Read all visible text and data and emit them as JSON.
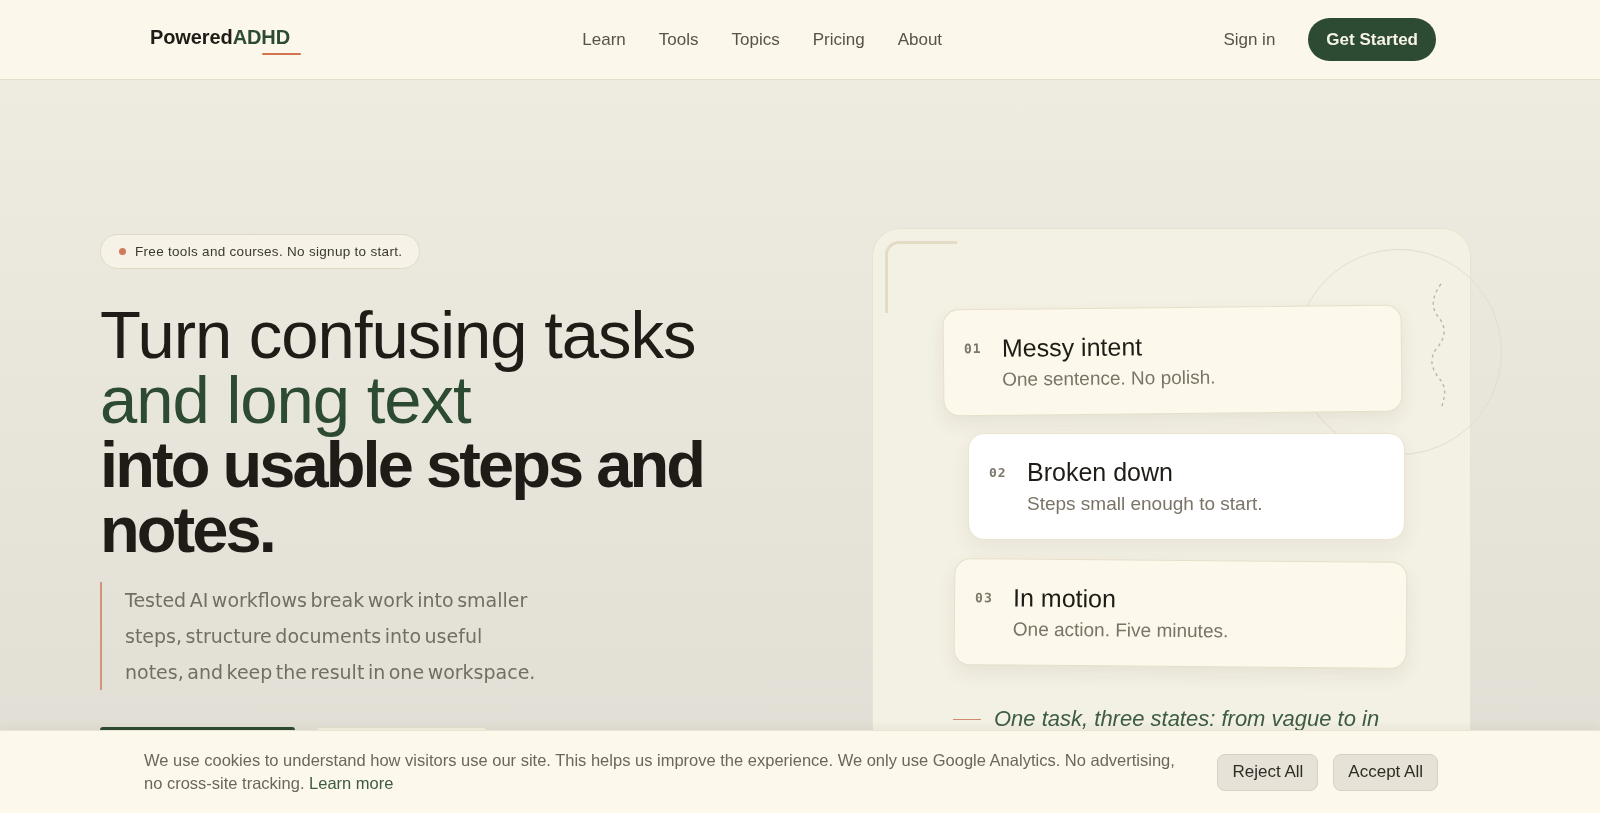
{
  "header": {
    "logo": {
      "text": "Powered",
      "accent": "ADHD"
    },
    "nav": [
      "Learn",
      "Tools",
      "Topics",
      "Pricing",
      "About"
    ],
    "sign_in": "Sign in",
    "cta": "Get Started"
  },
  "hero": {
    "badge": "Free tools and courses. No signup to start.",
    "headline": [
      {
        "text": "Turn confusing tasks",
        "kind": "regular"
      },
      {
        "text": "and long text",
        "kind": "accent"
      },
      {
        "text": "into usable steps and notes.",
        "kind": "strong"
      }
    ],
    "lead": "Tested AI workflows break work into smaller steps, structure documents into useful notes, and keep the result in one workspace.",
    "buttons": [
      {
        "kind": "primary"
      },
      {
        "kind": "secondary"
      }
    ]
  },
  "steps_panel": {
    "steps": [
      {
        "number": "01",
        "title": "Messy intent",
        "description": "One sentence. No polish.",
        "highlighted": false
      },
      {
        "number": "02",
        "title": "Broken down",
        "description": "Steps small enough to start.",
        "highlighted": true
      },
      {
        "number": "03",
        "title": "In motion",
        "description": "One action. Five minutes.",
        "highlighted": false
      }
    ],
    "caption": "One task, three states: from vague to in"
  },
  "cookie_banner": {
    "text": "We use cookies to understand how visitors use our site. This helps us improve the experience. We only use Google Analytics. No advertising, no cross-site tracking.",
    "link": "Learn more",
    "buttons": [
      "Reject All",
      "Accept All"
    ]
  }
}
